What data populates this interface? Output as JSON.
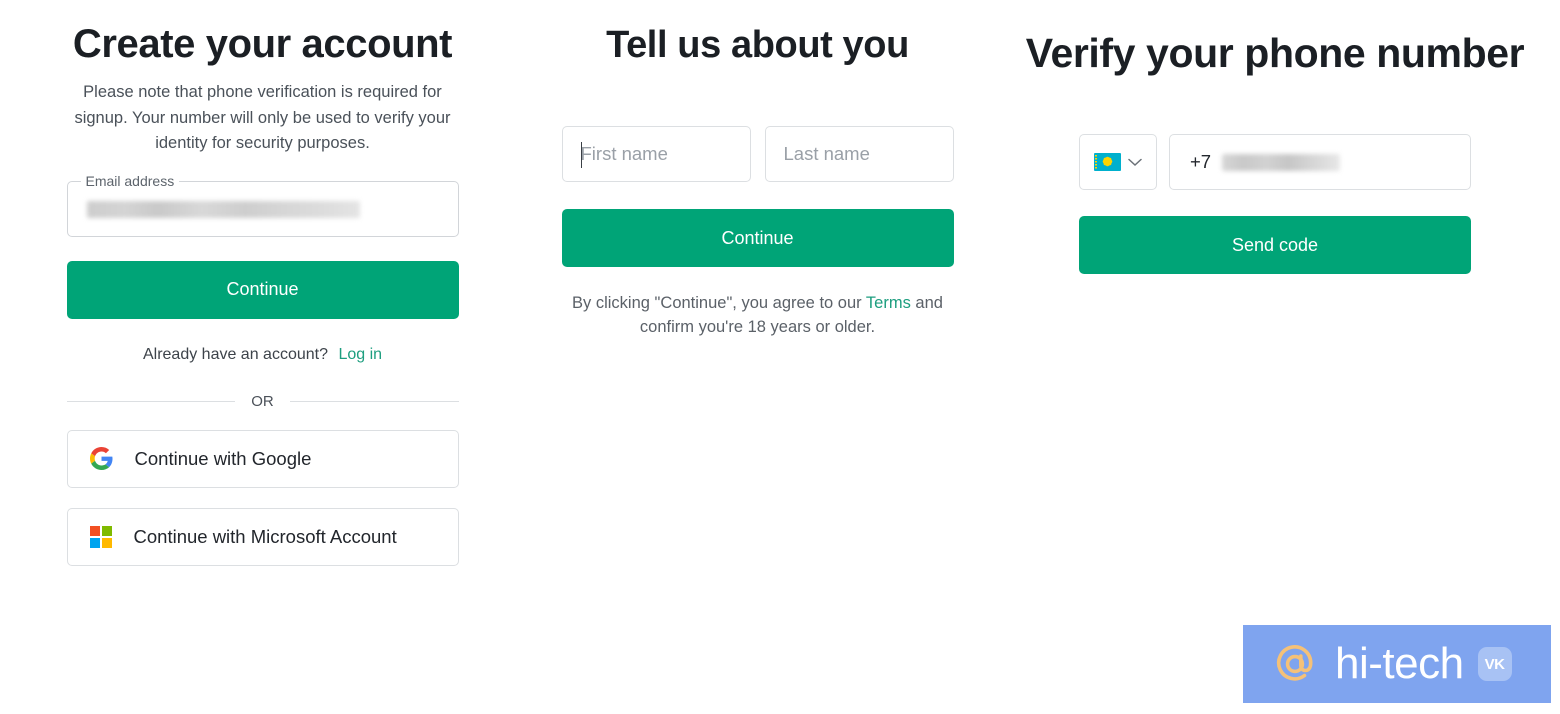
{
  "create_account": {
    "heading": "Create your account",
    "subtext": "Please note that phone verification is required for signup. Your number will only be used to verify your identity for security purposes.",
    "email_field": {
      "label": "Email address",
      "value_redacted": true
    },
    "continue_label": "Continue",
    "account_prompt": "Already have an account?",
    "login_label": "Log in",
    "or_label": "OR",
    "social_buttons": [
      {
        "icon": "google-icon",
        "label": "Continue with Google"
      },
      {
        "icon": "microsoft-icon",
        "label": "Continue with Microsoft Account"
      }
    ]
  },
  "tell_us": {
    "heading": "Tell us about you",
    "first_name_placeholder": "First name",
    "first_name_value": "",
    "last_name_placeholder": "Last name",
    "last_name_value": "",
    "continue_label": "Continue",
    "terms_prefix": "By clicking \"Continue\", you agree to our ",
    "terms_link": "Terms",
    "terms_suffix": " and confirm you're 18 years or older."
  },
  "verify_phone": {
    "heading": "Verify your phone number",
    "country_flag": "kazakhstan-flag-icon",
    "country_chevron": "chevron-down-icon",
    "phone_prefix": "+7",
    "phone_value_redacted": true,
    "send_code_label": "Send code"
  },
  "watermark": {
    "at_icon": "at-sign-icon",
    "text": "hi-tech",
    "badge": "VK"
  },
  "colors": {
    "primary_green": "#00a477",
    "link_teal": "#1d9e7f",
    "heading": "#1b1f24",
    "body_text": "#4a5159",
    "border": "#dcdfe2",
    "watermark_bg": "#7fa4ef",
    "flag_cyan": "#00b0cd",
    "flag_yellow": "#ffd400"
  }
}
